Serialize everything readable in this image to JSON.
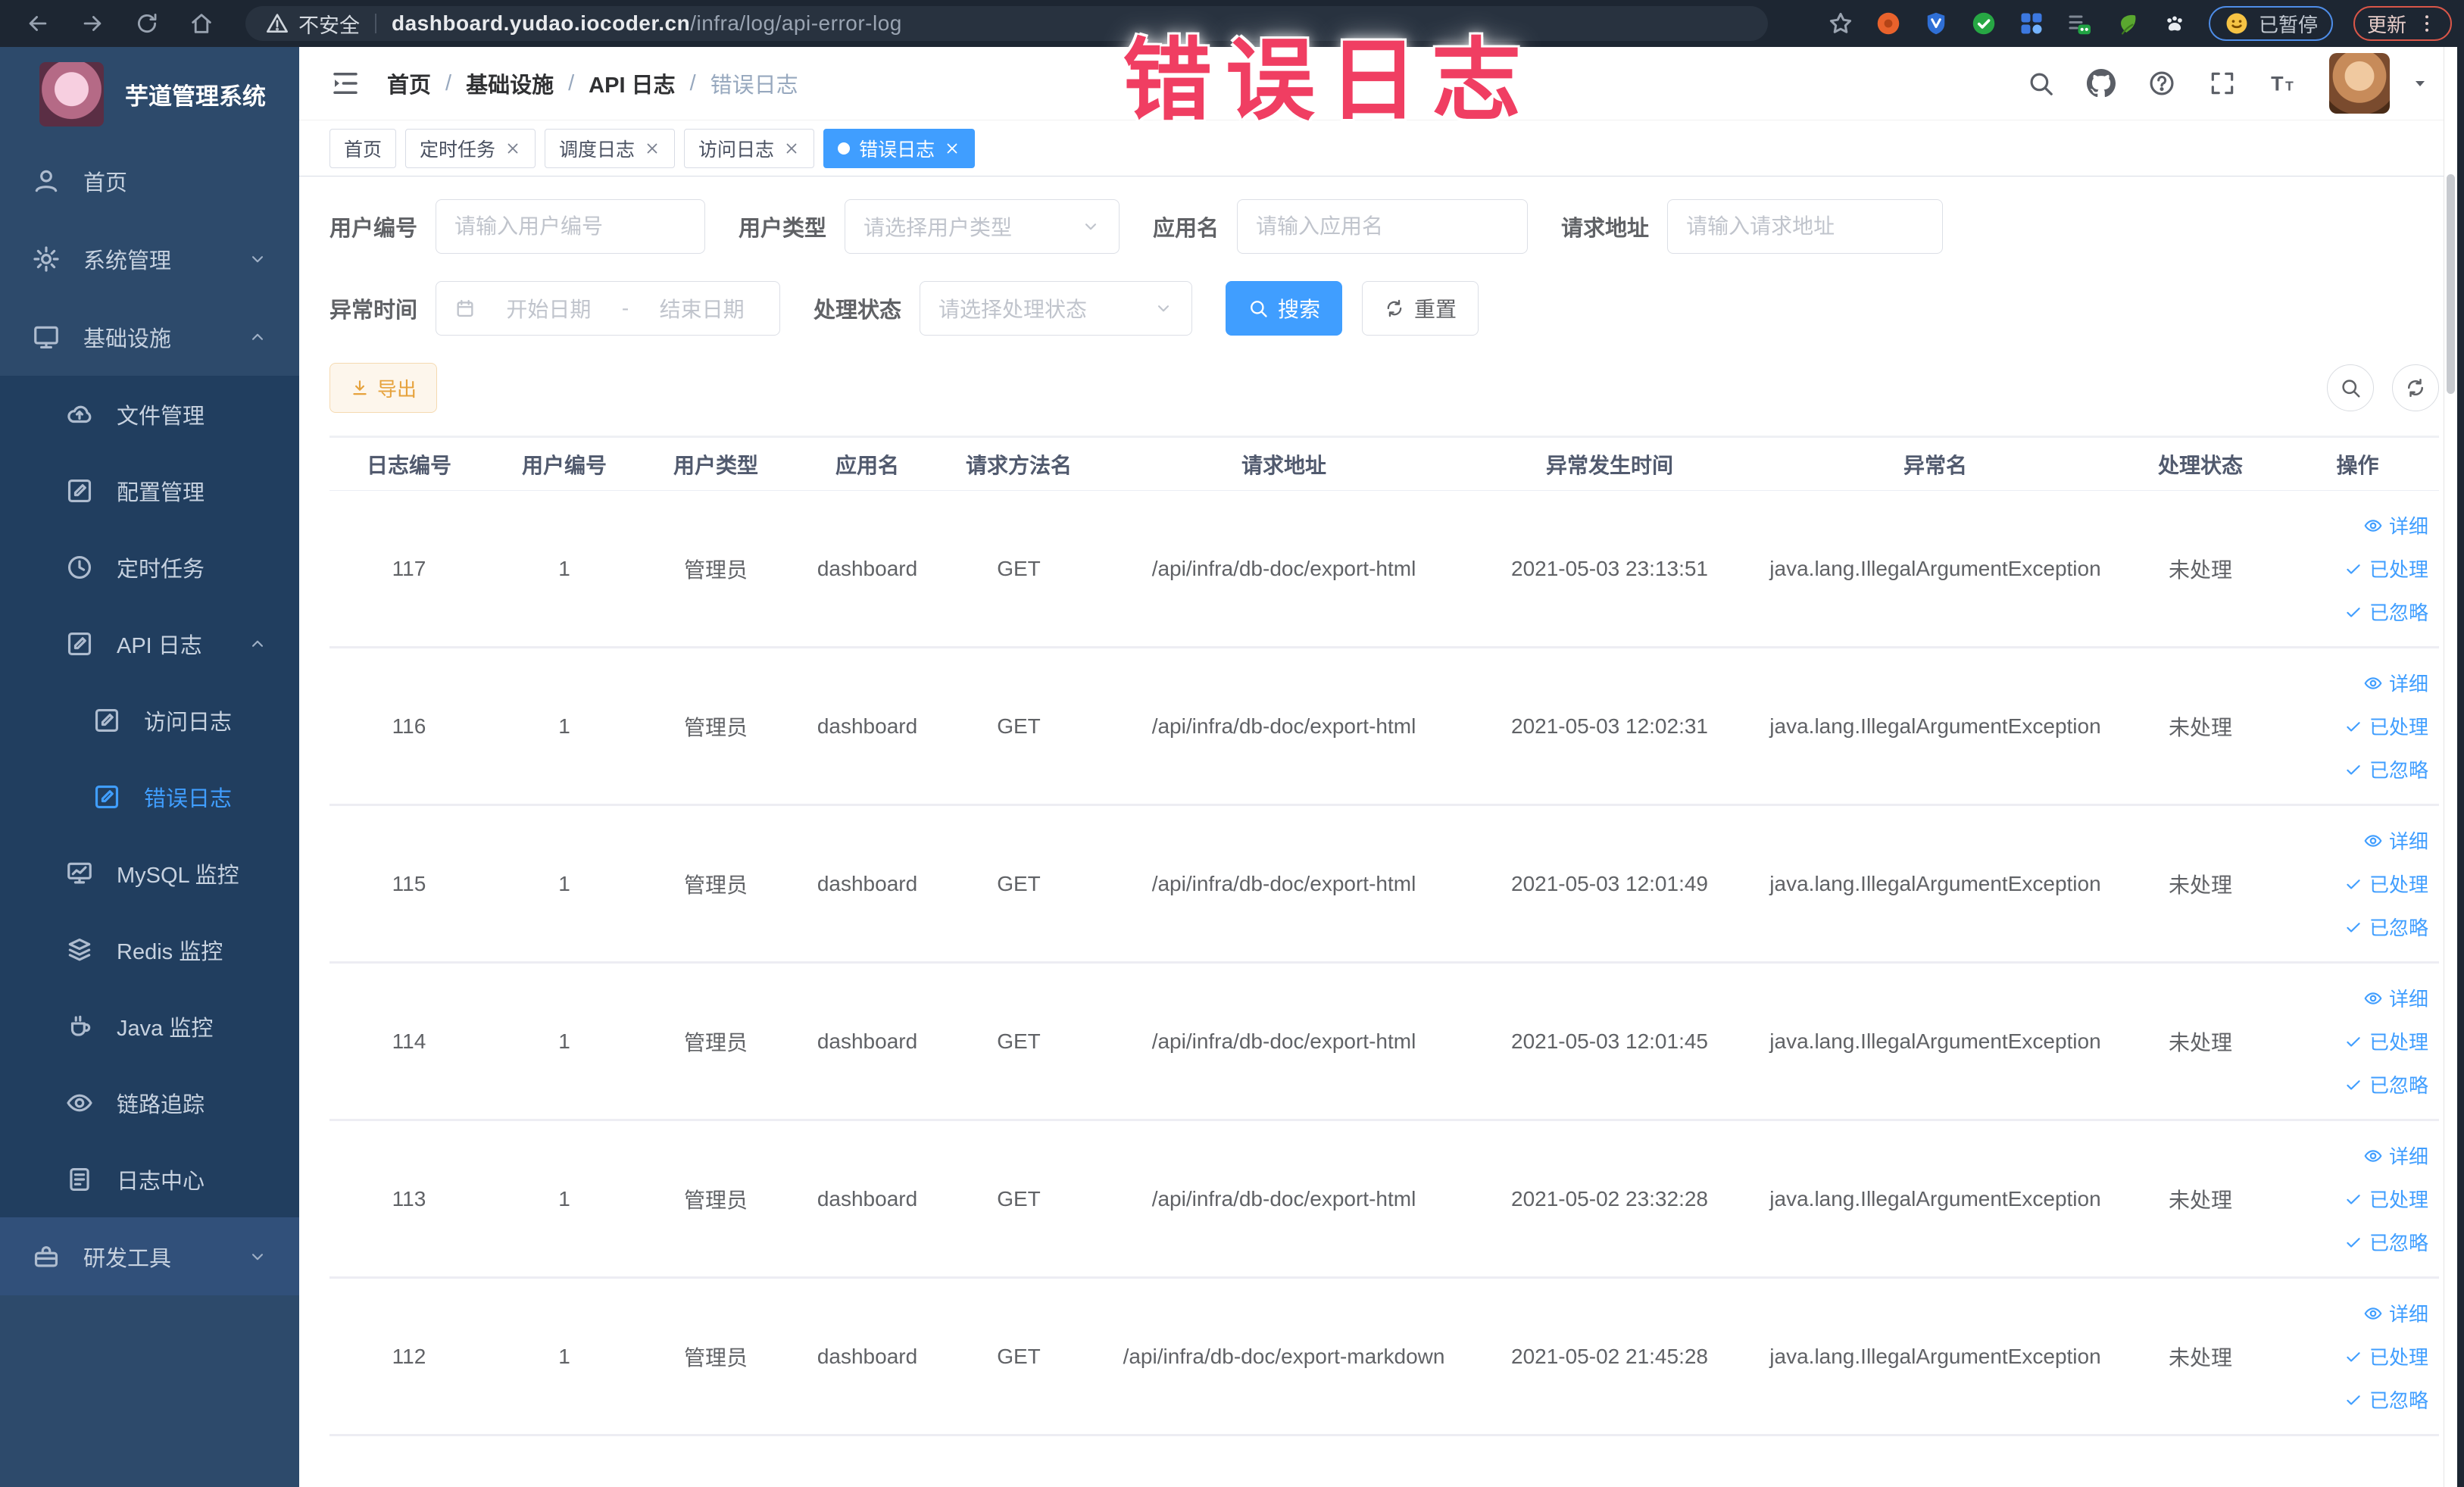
{
  "browser": {
    "nav_icons": [
      "back-icon",
      "forward-icon",
      "reload-icon",
      "home-icon"
    ],
    "security_label": "不安全",
    "url_domain": "dashboard.yudao.iocoder.cn",
    "url_path": "/infra/log/api-error-log",
    "bookmark_icon": "star-icon",
    "extension_icons": [
      "extension-orange-icon",
      "extension-shield-icon",
      "extension-green-check-icon",
      "extension-grid-icon",
      "extension-onoff-icon",
      "extension-leaf-icon",
      "extension-paw-icon"
    ],
    "paused_button": {
      "icon": "smiley-icon",
      "label": "已暂停"
    },
    "update_button": {
      "label": "更新",
      "menu_icon": "dots-vertical-icon"
    }
  },
  "annotation": "错误日志",
  "sidebar": {
    "logo_title": "芋道管理系统",
    "items": [
      {
        "label": "首页",
        "icon": "home-user-icon",
        "level": 1
      },
      {
        "label": "系统管理",
        "icon": "gear-icon",
        "level": 1,
        "chevron": "down"
      },
      {
        "label": "基础设施",
        "icon": "infra-icon",
        "level": 1,
        "chevron": "up"
      },
      {
        "label": "文件管理",
        "icon": "cloud-upload-icon",
        "level": 2,
        "sub": true
      },
      {
        "label": "配置管理",
        "icon": "edit-square-icon",
        "level": 2,
        "sub": true
      },
      {
        "label": "定时任务",
        "icon": "clock-icon",
        "level": 2,
        "sub": true
      },
      {
        "label": "API 日志",
        "icon": "edit-square-icon",
        "level": 2,
        "sub": true,
        "chevron": "up"
      },
      {
        "label": "访问日志",
        "icon": "edit-square-icon",
        "level": 3,
        "sub": true
      },
      {
        "label": "错误日志",
        "icon": "edit-square-icon",
        "level": 3,
        "sub": true,
        "active": true
      },
      {
        "label": "MySQL 监控",
        "icon": "monitor-chart-icon",
        "level": 2,
        "sub": true
      },
      {
        "label": "Redis 监控",
        "icon": "layers-icon",
        "level": 2,
        "sub": true
      },
      {
        "label": "Java 监控",
        "icon": "coffee-icon",
        "level": 2,
        "sub": true
      },
      {
        "label": "链路追踪",
        "icon": "eye-icon",
        "level": 2,
        "sub": true
      },
      {
        "label": "日志中心",
        "icon": "document-icon",
        "level": 2,
        "sub": true
      },
      {
        "label": "研发工具",
        "icon": "toolbox-icon",
        "level": 1,
        "chevron": "down",
        "hover": true
      }
    ]
  },
  "header": {
    "hamburger_icon": "hamburger-icon",
    "breadcrumb": [
      "首页",
      "基础设施",
      "API 日志",
      "错误日志"
    ],
    "breadcrumb_separator": "/",
    "right_icons": [
      "search-icon",
      "github-icon",
      "help-icon",
      "fullscreen-icon",
      "font-size-icon"
    ],
    "tabs": [
      {
        "label": "首页",
        "closable": false,
        "active": false
      },
      {
        "label": "定时任务",
        "closable": true,
        "active": false
      },
      {
        "label": "调度日志",
        "closable": true,
        "active": false
      },
      {
        "label": "访问日志",
        "closable": true,
        "active": false
      },
      {
        "label": "错误日志",
        "closable": true,
        "active": true
      }
    ]
  },
  "filters": {
    "user_id": {
      "label": "用户编号",
      "placeholder": "请输入用户编号"
    },
    "user_type": {
      "label": "用户类型",
      "placeholder": "请选择用户类型"
    },
    "app_name": {
      "label": "应用名",
      "placeholder": "请输入应用名"
    },
    "req_url": {
      "label": "请求地址",
      "placeholder": "请输入请求地址"
    },
    "time": {
      "label": "异常时间",
      "start_placeholder": "开始日期",
      "separator": "-",
      "end_placeholder": "结束日期",
      "icon": "calendar-icon"
    },
    "status": {
      "label": "处理状态",
      "placeholder": "请选择处理状态"
    },
    "search_label": "搜索",
    "reset_label": "重置"
  },
  "toolbar": {
    "export_label": "导出",
    "export_icon": "download-icon",
    "search_toggle_icon": "search-icon",
    "refresh_icon": "refresh-icon"
  },
  "table": {
    "columns": [
      "日志编号",
      "用户编号",
      "用户类型",
      "应用名",
      "请求方法名",
      "请求地址",
      "异常发生时间",
      "异常名",
      "处理状态",
      "操作"
    ],
    "row_actions": [
      {
        "label": "详细",
        "icon": "eye-icon"
      },
      {
        "label": "已处理",
        "icon": "check-icon"
      },
      {
        "label": "已忽略",
        "icon": "check-icon"
      }
    ],
    "rows": [
      {
        "log_id": "117",
        "user_id": "1",
        "user_type": "管理员",
        "app_name": "dashboard",
        "method": "GET",
        "url": "/api/infra/db-doc/export-html",
        "time": "2021-05-03 23:13:51",
        "exception": "java.lang.IllegalArgumentException",
        "status": "未处理"
      },
      {
        "log_id": "116",
        "user_id": "1",
        "user_type": "管理员",
        "app_name": "dashboard",
        "method": "GET",
        "url": "/api/infra/db-doc/export-html",
        "time": "2021-05-03 12:02:31",
        "exception": "java.lang.IllegalArgumentException",
        "status": "未处理"
      },
      {
        "log_id": "115",
        "user_id": "1",
        "user_type": "管理员",
        "app_name": "dashboard",
        "method": "GET",
        "url": "/api/infra/db-doc/export-html",
        "time": "2021-05-03 12:01:49",
        "exception": "java.lang.IllegalArgumentException",
        "status": "未处理"
      },
      {
        "log_id": "114",
        "user_id": "1",
        "user_type": "管理员",
        "app_name": "dashboard",
        "method": "GET",
        "url": "/api/infra/db-doc/export-html",
        "time": "2021-05-03 12:01:45",
        "exception": "java.lang.IllegalArgumentException",
        "status": "未处理"
      },
      {
        "log_id": "113",
        "user_id": "1",
        "user_type": "管理员",
        "app_name": "dashboard",
        "method": "GET",
        "url": "/api/infra/db-doc/export-html",
        "time": "2021-05-02 23:32:28",
        "exception": "java.lang.IllegalArgumentException",
        "status": "未处理"
      },
      {
        "log_id": "112",
        "user_id": "1",
        "user_type": "管理员",
        "app_name": "dashboard",
        "method": "GET",
        "url": "/api/infra/db-doc/export-markdown",
        "time": "2021-05-02 21:45:28",
        "exception": "java.lang.IllegalArgumentException",
        "status": "未处理"
      }
    ]
  },
  "colors": {
    "accent_blue": "#409eff",
    "sidebar_bg": "#2d4a6b",
    "sidebar_sub_bg": "#213e5f",
    "export_orange": "#e6a23c",
    "annotation_pink": "#f03e62",
    "chrome_bar": "#1d2632"
  }
}
